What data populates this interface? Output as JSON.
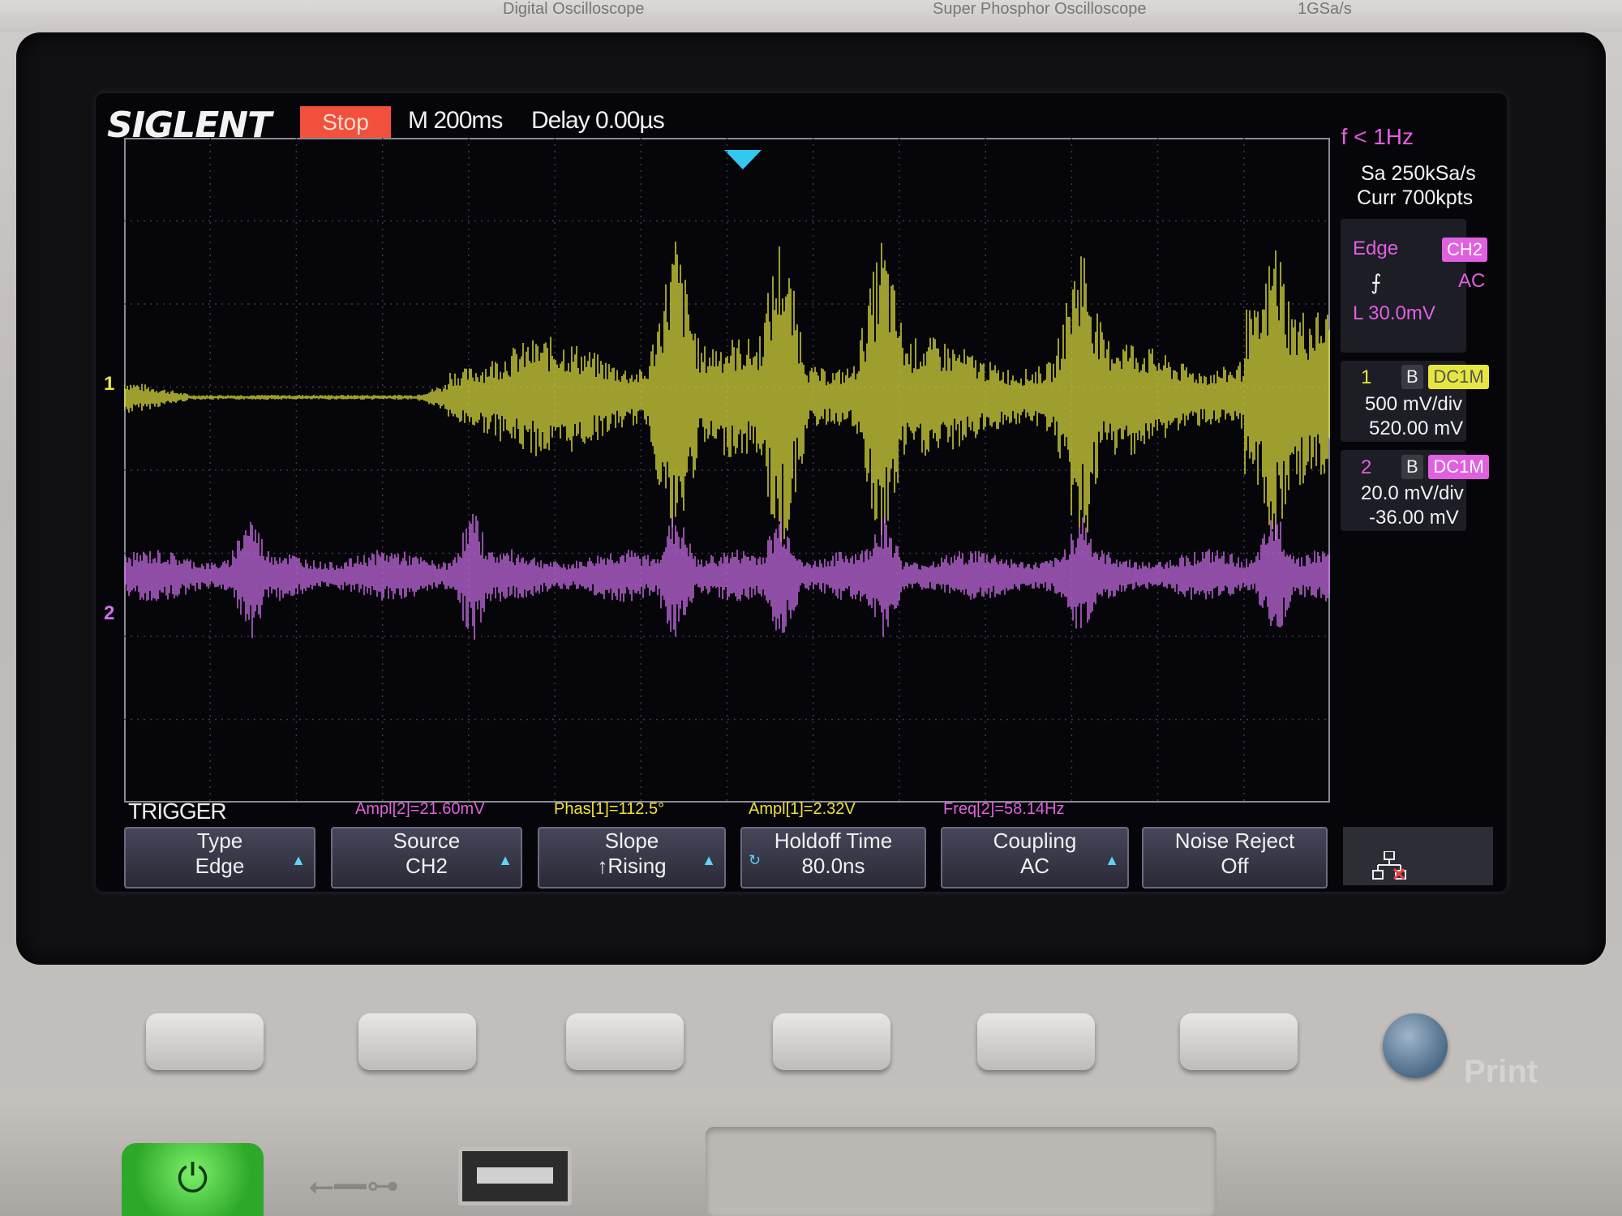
{
  "device": {
    "brand": "SIGLENT",
    "top_labels": [
      "Digital Oscilloscope",
      "Super Phosphor Oscilloscope",
      "1GSa/s"
    ]
  },
  "header": {
    "run_state": "Stop",
    "timebase": "M 200ms",
    "delay": "Delay 0.00µs",
    "trigger_frequency": "f < 1Hz"
  },
  "acquisition": {
    "sample_rate": "Sa 250kSa/s",
    "memory_depth": "Curr 700kpts"
  },
  "trigger_info": {
    "type": "Edge",
    "source": "CH2",
    "slope_icon": "rising-edge-icon",
    "coupling": "AC",
    "level": "L  30.0mV"
  },
  "channels": [
    {
      "number": "1",
      "coupling": "DC1M",
      "scale": "500 mV/div",
      "offset": "520.00 mV",
      "marker": "1",
      "color": "#e6e640"
    },
    {
      "number": "2",
      "coupling": "DC1M",
      "scale": "20.0 mV/div",
      "offset": "-36.00 mV",
      "marker": "2",
      "color": "#d070f0"
    }
  ],
  "measurements": [
    {
      "text": "Ampl[2]=21.60mV",
      "color": "#e060e0"
    },
    {
      "text": "Phas[1]=112.5°",
      "color": "#f0e040"
    },
    {
      "text": "Ampl[1]=2.32V",
      "color": "#f0e040"
    },
    {
      "text": "Freq[2]=58.14Hz",
      "color": "#e060e0"
    }
  ],
  "menu": {
    "title": "TRIGGER",
    "softkeys": [
      {
        "label": "Type",
        "value": "Edge"
      },
      {
        "label": "Source",
        "value": "CH2"
      },
      {
        "label": "Slope",
        "value": "↑Rising"
      },
      {
        "label": "Holdoff Time",
        "value": "80.0ns"
      },
      {
        "label": "Coupling",
        "value": "AC"
      },
      {
        "label": "Noise Reject",
        "value": "Off"
      }
    ]
  },
  "hardware": {
    "print_label": "Print",
    "power_icon": "power-icon",
    "usb_icon": "usb-icon",
    "network_icon": "network-icon"
  },
  "colors": {
    "ch1": "#e6e640",
    "ch2": "#d070f0",
    "stop_bg": "#f0503c",
    "trigger_marker": "#33c8f0"
  }
}
